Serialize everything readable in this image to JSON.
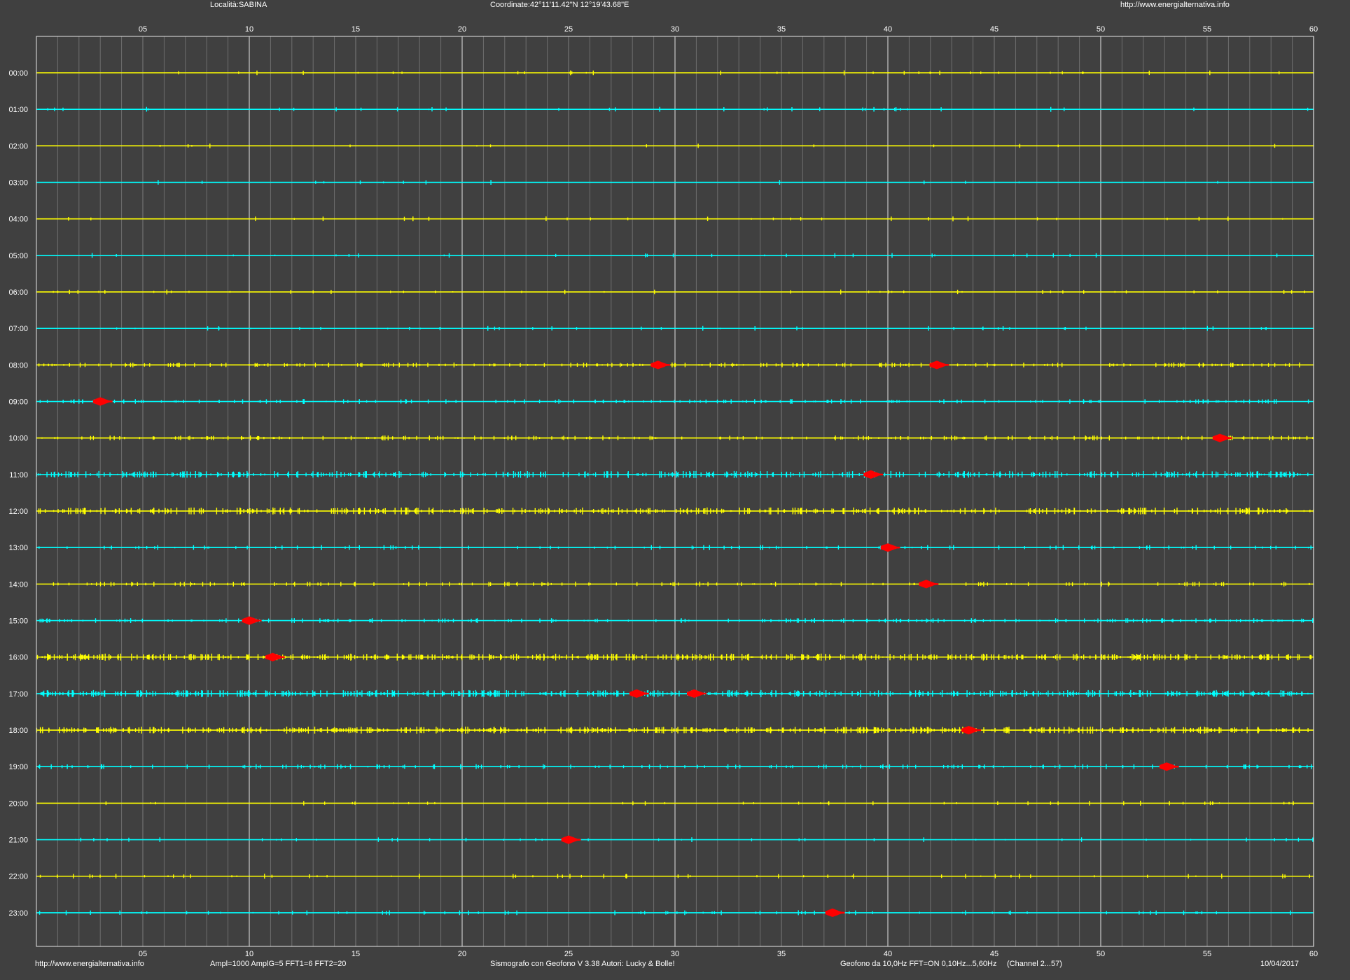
{
  "header": {
    "location": "Località:SABINA",
    "coordinates": "Coordinate:42°11'11.42\"N  12°19'43.68\"E",
    "website": "http://www.energialternativa.info"
  },
  "footer": {
    "website": "http://www.energialternativa.info",
    "amplification": "Ampl=1000 AmplG=5 FFT1=6 FFT2=20",
    "software": "Sismografo con Geofono V 3.38  Autori: Lucky & Bolle!",
    "sensor": "Geofono da 10,0Hz FFT=ON 0,10Hz...5,60Hz",
    "channel": "(Channel 2...57)",
    "date": "10/04/2017"
  },
  "colors": {
    "background": "#404040",
    "frame": "#e6e6e6",
    "major_grid": "#c8c8c8",
    "minor_grid": "#6e6e6e",
    "trace_even_hour": "#ffff00",
    "trace_odd_hour": "#00ffff",
    "event_marker": "#ff0000"
  },
  "chart_data": {
    "type": "line",
    "description_type": "helicorder",
    "x_unit": "minutes",
    "xlim": [
      0,
      60
    ],
    "x_tick_labels": [
      "05",
      "10",
      "15",
      "20",
      "25",
      "30",
      "35",
      "40",
      "45",
      "50",
      "55",
      "60"
    ],
    "x_ticks": [
      5,
      10,
      15,
      20,
      25,
      30,
      35,
      40,
      45,
      50,
      55,
      60
    ],
    "hour_labels": [
      "00:00",
      "01:00",
      "02:00",
      "03:00",
      "04:00",
      "05:00",
      "06:00",
      "07:00",
      "08:00",
      "09:00",
      "10:00",
      "11:00",
      "12:00",
      "13:00",
      "14:00",
      "15:00",
      "16:00",
      "17:00",
      "18:00",
      "19:00",
      "20:00",
      "21:00",
      "22:00",
      "23:00"
    ],
    "rows": [
      {
        "hour": "00:00",
        "noise": 0.05,
        "events": []
      },
      {
        "hour": "01:00",
        "noise": 0.05,
        "events": []
      },
      {
        "hour": "02:00",
        "noise": 0.02,
        "events": []
      },
      {
        "hour": "03:00",
        "noise": 0.02,
        "events": []
      },
      {
        "hour": "04:00",
        "noise": 0.04,
        "events": []
      },
      {
        "hour": "05:00",
        "noise": 0.04,
        "events": []
      },
      {
        "hour": "06:00",
        "noise": 0.06,
        "events": []
      },
      {
        "hour": "07:00",
        "noise": 0.06,
        "events": []
      },
      {
        "hour": "08:00",
        "noise": 0.3,
        "events": [
          29.2,
          42.3
        ]
      },
      {
        "hour": "09:00",
        "noise": 0.25,
        "events": [
          3.0
        ]
      },
      {
        "hour": "10:00",
        "noise": 0.3,
        "events": [
          55.6
        ]
      },
      {
        "hour": "11:00",
        "noise": 0.6,
        "events": [
          39.2
        ]
      },
      {
        "hour": "12:00",
        "noise": 0.6,
        "events": []
      },
      {
        "hour": "13:00",
        "noise": 0.15,
        "events": [
          40.0
        ]
      },
      {
        "hour": "14:00",
        "noise": 0.2,
        "events": [
          41.8
        ]
      },
      {
        "hour": "15:00",
        "noise": 0.3,
        "events": [
          10.0
        ]
      },
      {
        "hour": "16:00",
        "noise": 0.75,
        "events": [
          11.1
        ]
      },
      {
        "hour": "17:00",
        "noise": 0.75,
        "events": [
          28.2,
          30.9
        ]
      },
      {
        "hour": "18:00",
        "noise": 0.75,
        "events": [
          43.8
        ]
      },
      {
        "hour": "19:00",
        "noise": 0.2,
        "events": [
          53.1
        ]
      },
      {
        "hour": "20:00",
        "noise": 0.06,
        "events": []
      },
      {
        "hour": "21:00",
        "noise": 0.06,
        "events": [
          25.0
        ]
      },
      {
        "hour": "22:00",
        "noise": 0.08,
        "events": []
      },
      {
        "hour": "23:00",
        "noise": 0.1,
        "events": [
          37.4
        ]
      }
    ]
  }
}
